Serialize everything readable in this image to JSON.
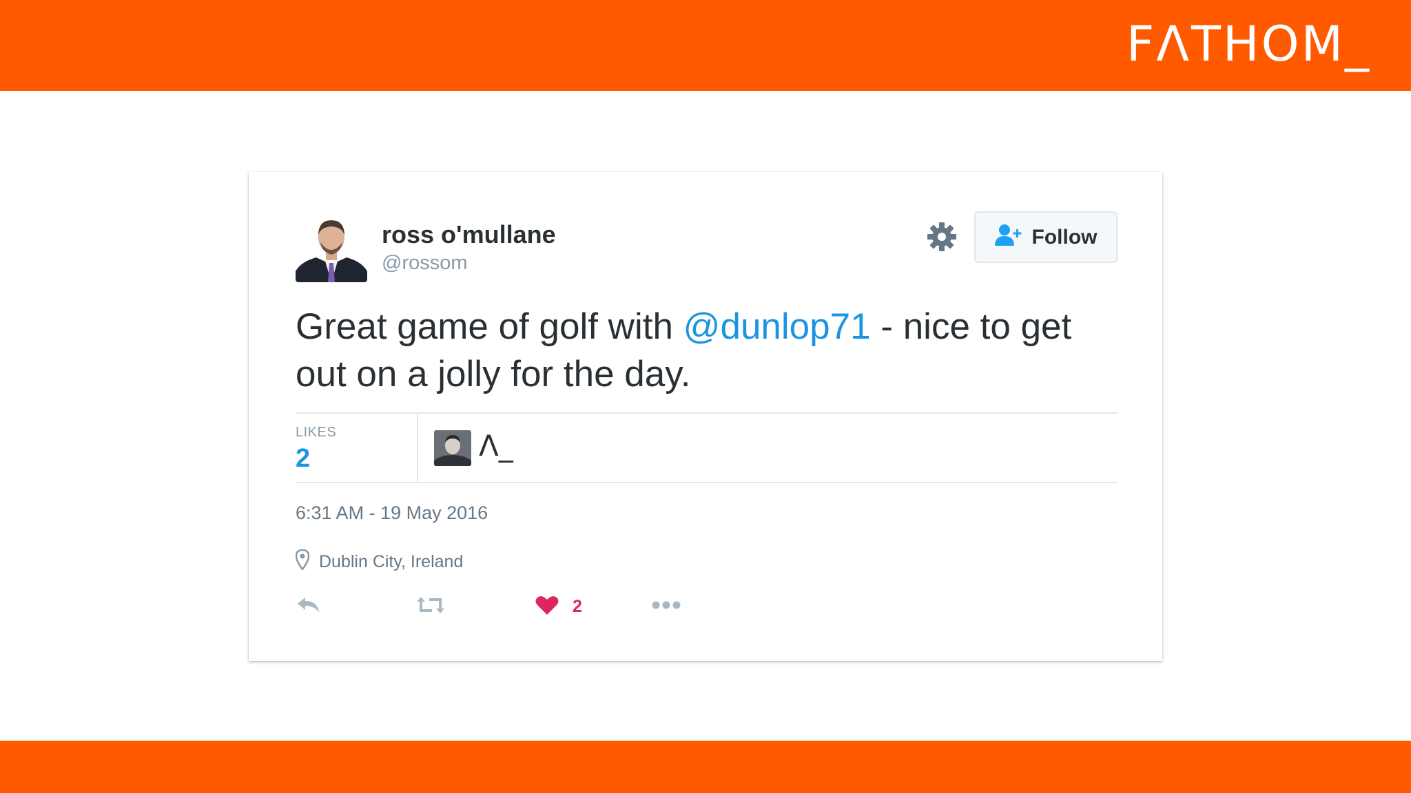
{
  "brand": {
    "logo_text": "FΛTHOM_",
    "color": "#ff5a00"
  },
  "tweet": {
    "user": {
      "name": "ross o'mullane",
      "handle": "@rossom"
    },
    "follow_label": "Follow",
    "text_before": "Great game of golf with ",
    "mention": "@dunlop71",
    "text_after": " - nice to get out on a jolly for the day.",
    "likes_label": "LIKES",
    "likes_count": "2",
    "liker_label": "Λ_",
    "timestamp": "6:31 AM - 19 May 2016",
    "location": "Dublin City, Ireland",
    "actions": {
      "reply_icon": "reply-icon",
      "retweet_icon": "retweet-icon",
      "like_icon": "heart-icon",
      "like_count": "2",
      "more_icon": "more-icon"
    },
    "colors": {
      "link": "#1b95e0",
      "like": "#e0245e",
      "muted": "#8899a6"
    }
  }
}
